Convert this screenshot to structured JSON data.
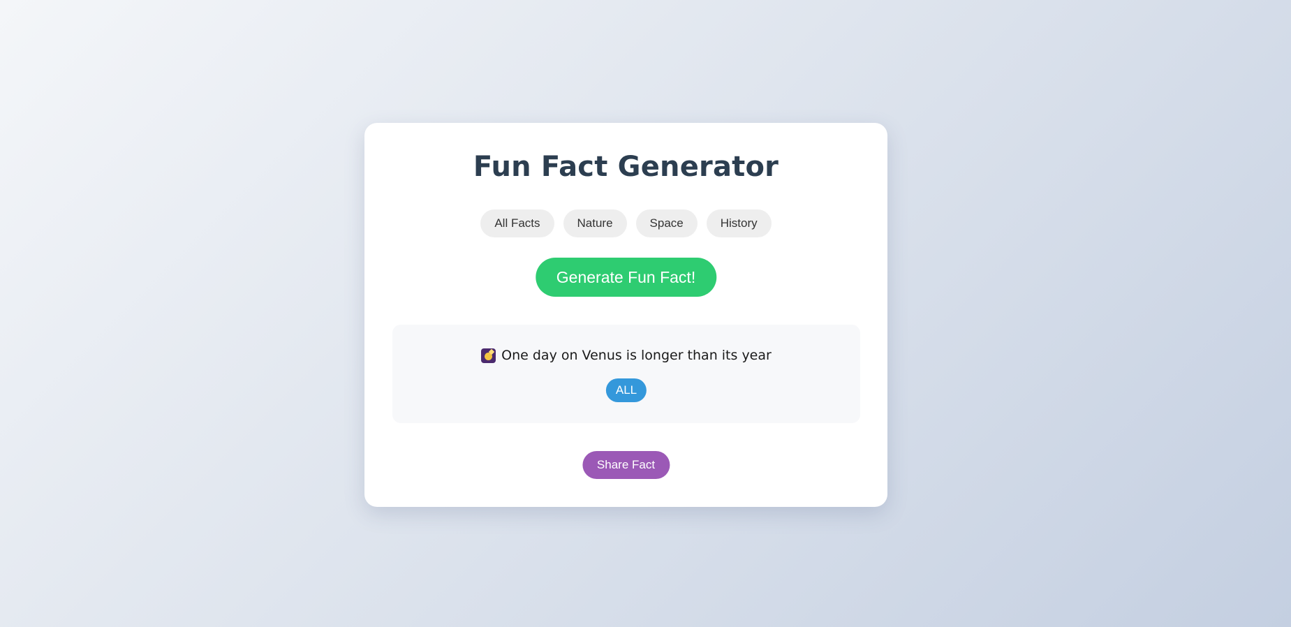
{
  "app": {
    "title": "Fun Fact Generator"
  },
  "categories": [
    {
      "label": "All Facts"
    },
    {
      "label": "Nature"
    },
    {
      "label": "Space"
    },
    {
      "label": "History"
    }
  ],
  "generate_label": "Generate Fun Fact!",
  "fact": {
    "icon": "shooting-star-icon",
    "text": "One day on Venus is longer than its year",
    "category_badge": "ALL"
  },
  "share_label": "Share Fact",
  "colors": {
    "generate": "#2ecc71",
    "badge": "#3498db",
    "share": "#9b59b6",
    "title": "#2c3e50"
  }
}
